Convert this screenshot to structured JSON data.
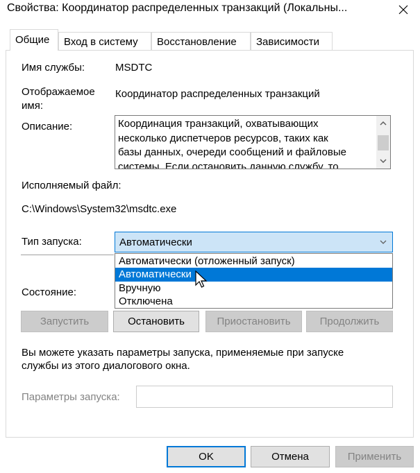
{
  "window": {
    "title": "Свойства: Координатор распределенных транзакций (Локальны...",
    "close_icon": "close-icon"
  },
  "tabs": [
    {
      "label": "Общие",
      "active": true
    },
    {
      "label": "Вход в систему",
      "active": false
    },
    {
      "label": "Восстановление",
      "active": false
    },
    {
      "label": "Зависимости",
      "active": false
    }
  ],
  "general": {
    "service_name_label": "Имя службы:",
    "service_name_value": "MSDTC",
    "display_name_label_line1": "Отображаемое",
    "display_name_label_line2": "имя:",
    "display_name_value": "Координатор распределенных транзакций",
    "description_label": "Описание:",
    "description_lines": [
      "Координация транзакций, охватывающих",
      "несколько диспетчеров ресурсов, таких как",
      "базы данных, очереди сообщений и файловые",
      "системы. Если остановить данную службу, то"
    ],
    "executable_label": "Исполняемый файл:",
    "executable_value": "C:\\Windows\\System32\\msdtc.exe",
    "startup_type_label": "Тип запуска:",
    "startup_type_value": "Автоматически",
    "startup_options": [
      "Автоматически (отложенный запуск)",
      "Автоматически",
      "Вручную",
      "Отключена"
    ],
    "startup_options_selected_index": 1,
    "status_label": "Состояние:",
    "buttons": {
      "start": "Запустить",
      "stop": "Остановить",
      "pause": "Приостановить",
      "resume": "Продолжить"
    },
    "hint_line1": "Вы можете указать параметры запуска, применяемые при запуске",
    "hint_line2": "службы из этого диалогового окна.",
    "params_label": "Параметры запуска:",
    "params_value": ""
  },
  "footer": {
    "ok": "OK",
    "cancel": "Отмена",
    "apply": "Применить"
  },
  "colors": {
    "accent": "#0078d7",
    "select_bg": "#cce4f7",
    "disabled_bg": "#cccccc",
    "disabled_text": "#838383"
  }
}
